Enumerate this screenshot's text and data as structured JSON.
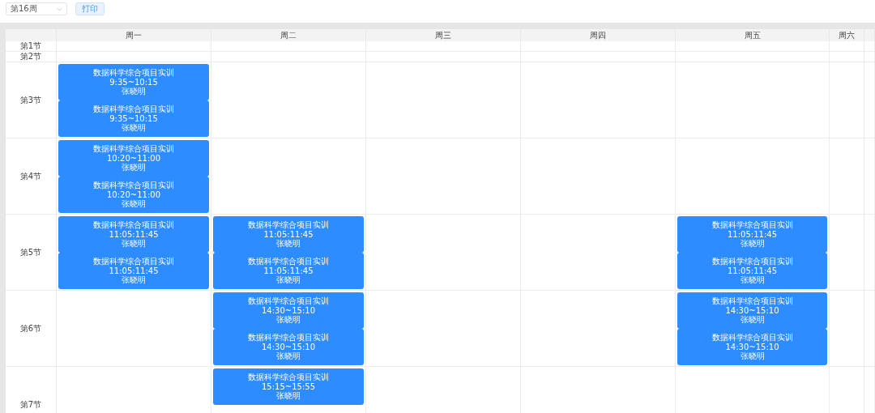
{
  "toolbar": {
    "week_select": {
      "value": "第16周"
    },
    "print_button": {
      "label": "打印"
    }
  },
  "timetable": {
    "columns": [
      "周一",
      "周二",
      "周三",
      "周四",
      "周五",
      "周六",
      ""
    ],
    "periods": [
      {
        "label": "第1节",
        "cells": [
          [],
          [],
          [],
          [],
          [],
          [],
          []
        ]
      },
      {
        "label": "第2节",
        "cells": [
          [],
          [],
          [],
          [],
          [],
          [],
          []
        ]
      },
      {
        "label": "第3节",
        "cells": [
          [
            {
              "title": "数据科学综合项目实训",
              "time": "9:35~10:15",
              "teacher": "张晓明"
            },
            {
              "title": "数据科学综合项目实训",
              "time": "9:35~10:15",
              "teacher": "张晓明"
            }
          ],
          [],
          [],
          [],
          [],
          [],
          []
        ]
      },
      {
        "label": "第4节",
        "cells": [
          [
            {
              "title": "数据科学综合项目实训",
              "time": "10:20~11:00",
              "teacher": "张晓明"
            },
            {
              "title": "数据科学综合项目实训",
              "time": "10:20~11:00",
              "teacher": "张晓明"
            }
          ],
          [],
          [],
          [],
          [],
          [],
          []
        ]
      },
      {
        "label": "第5节",
        "cells": [
          [
            {
              "title": "数据科学综合项目实训",
              "time": "11:05:11:45",
              "teacher": "张晓明"
            },
            {
              "title": "数据科学综合项目实训",
              "time": "11:05:11:45",
              "teacher": "张晓明"
            }
          ],
          [
            {
              "title": "数据科学综合项目实训",
              "time": "11:05:11:45",
              "teacher": "张晓明"
            },
            {
              "title": "数据科学综合项目实训",
              "time": "11:05:11:45",
              "teacher": "张晓明"
            }
          ],
          [],
          [],
          [
            {
              "title": "数据科学综合项目实训",
              "time": "11:05:11:45",
              "teacher": "张晓明"
            },
            {
              "title": "数据科学综合项目实训",
              "time": "11:05:11:45",
              "teacher": "张晓明"
            }
          ],
          [],
          []
        ]
      },
      {
        "label": "第6节",
        "cells": [
          [],
          [
            {
              "title": "数据科学综合项目实训",
              "time": "14:30~15:10",
              "teacher": "张晓明"
            },
            {
              "title": "数据科学综合项目实训",
              "time": "14:30~15:10",
              "teacher": "张晓明"
            }
          ],
          [],
          [],
          [
            {
              "title": "数据科学综合项目实训",
              "time": "14:30~15:10",
              "teacher": "张晓明"
            },
            {
              "title": "数据科学综合项目实训",
              "time": "14:30~15:10",
              "teacher": "张晓明"
            }
          ],
          [],
          []
        ]
      },
      {
        "label": "第7节",
        "cells": [
          [],
          [
            {
              "title": "数据科学综合项目实训",
              "time": "15:15~15:55",
              "teacher": "张晓明"
            }
          ],
          [],
          [],
          [],
          [],
          []
        ]
      }
    ]
  }
}
